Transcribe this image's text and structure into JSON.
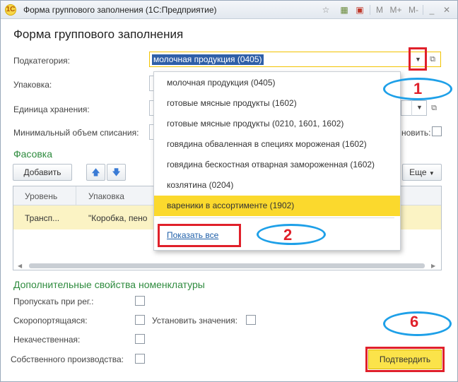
{
  "window": {
    "title": "Форма группового заполнения (1С:Предприятие)",
    "toolbar_m": "M",
    "toolbar_mplus": "M+",
    "toolbar_mminus": "M-"
  },
  "form": {
    "heading": "Форма группового заполнения"
  },
  "fields": {
    "subcategory_label": "Подкатегория:",
    "subcategory_value": "молочная продукция (0405)",
    "packaging_label": "Упаковка:",
    "storage_unit_label": "Единица хранения:",
    "min_writeoff_label": "Минимальный объем списания:",
    "set_label_partial": "новить:"
  },
  "packing": {
    "section_title": "Фасовка",
    "add_button": "Добавить",
    "more_button": "Еще",
    "columns": [
      "Уровень",
      "Упаковка"
    ],
    "rows": [
      {
        "level": "Трансп...",
        "packaging": "\"Коробка, пено"
      }
    ]
  },
  "dropdown": {
    "items": [
      "молочная продукция (0405)",
      "готовые мясные продукты (1602)",
      "готовые мясные продукты (0210, 1601, 1602)",
      "говядина обваленная в специях мороженая (1602)",
      "говядина бескостная отварная замороженная (1602)",
      "козлятина (0204)",
      "вареники в ассортименте (1902)"
    ],
    "show_all": "Показать все"
  },
  "extra": {
    "section_title": "Дополнительные свойства номенклатуры",
    "skip_label": "Пропускать при рег.:",
    "perishable_label": "Скоропортящаяся:",
    "set_values_label": "Установить значения:",
    "poor_quality_label": "Некачественная:",
    "own_production_label": "Собственного производства:"
  },
  "confirm_button": "Подтвердить",
  "annotations": {
    "n1": "1",
    "n2": "2",
    "n6": "6"
  }
}
